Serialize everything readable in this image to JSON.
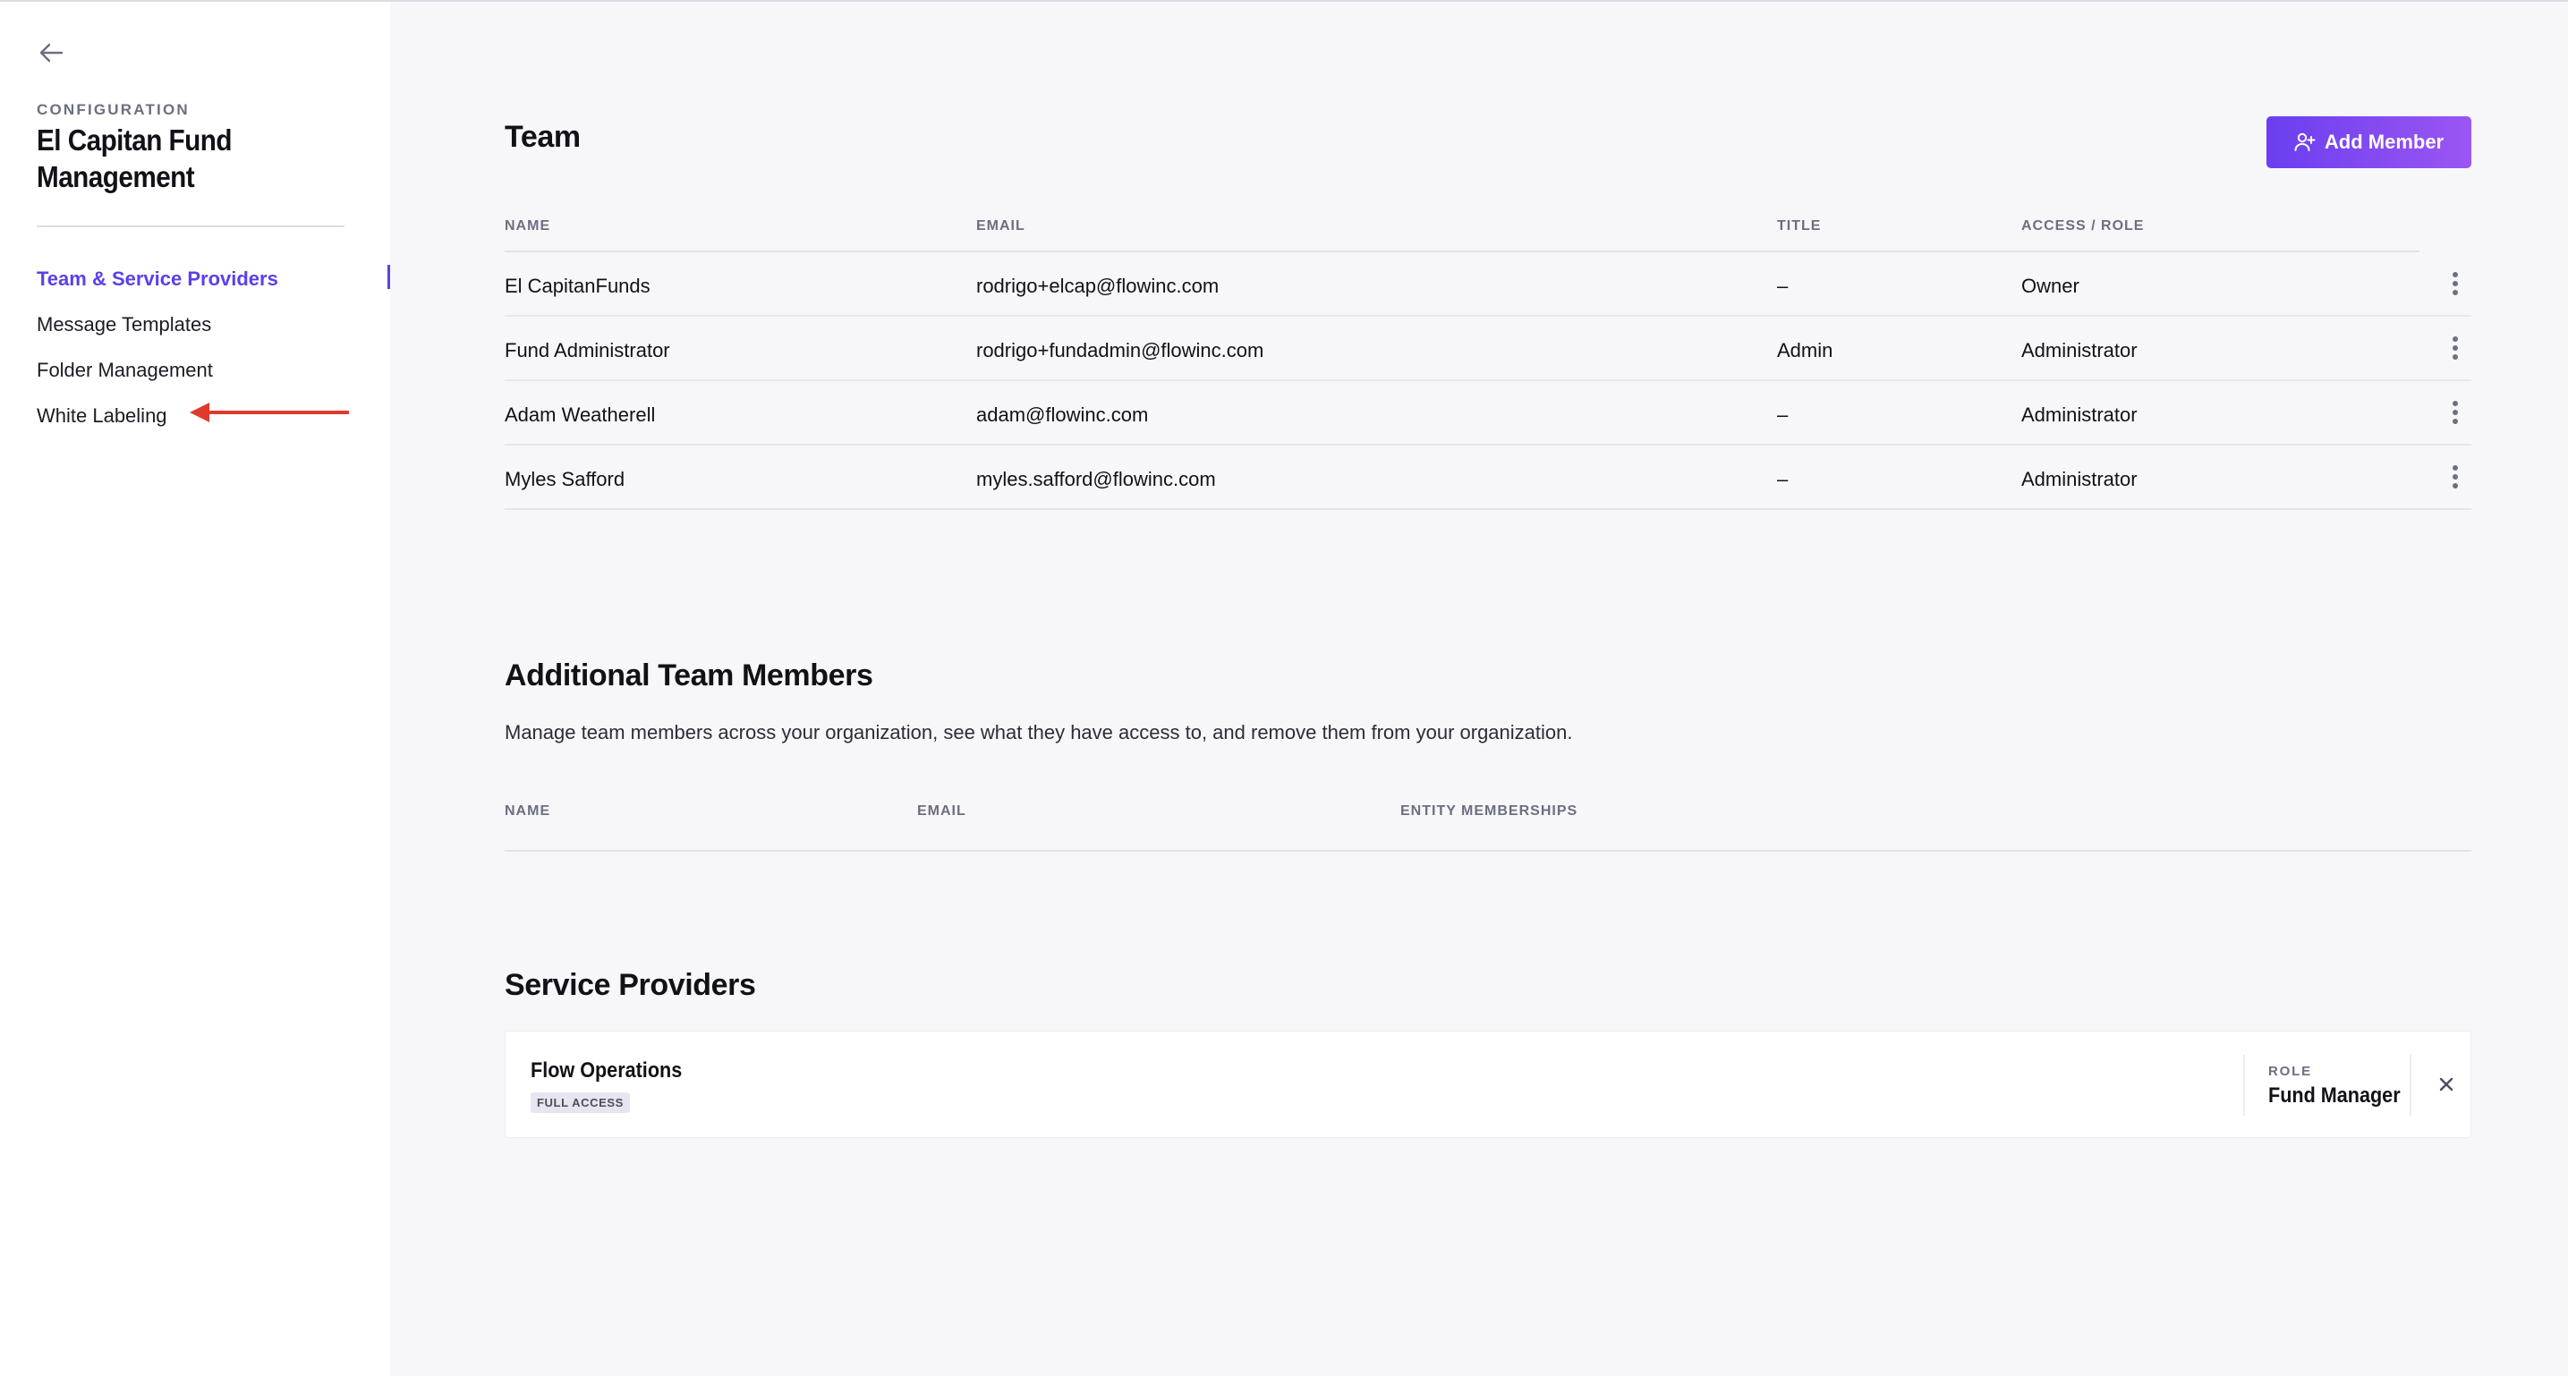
{
  "sidebar": {
    "section_label": "CONFIGURATION",
    "org_name": "El Capitan Fund Management",
    "nav": [
      {
        "label": "Team & Service Providers",
        "active": true
      },
      {
        "label": "Message Templates",
        "active": false
      },
      {
        "label": "Folder Management",
        "active": false
      },
      {
        "label": "White Labeling",
        "active": false
      }
    ]
  },
  "team": {
    "title": "Team",
    "add_button_label": "Add Member",
    "columns": [
      "NAME",
      "EMAIL",
      "TITLE",
      "ACCESS / ROLE"
    ],
    "rows": [
      {
        "name": "El CapitanFunds",
        "email": "rodrigo+elcap@flowinc.com",
        "title": "–",
        "role": "Owner"
      },
      {
        "name": "Fund Administrator",
        "email": "rodrigo+fundadmin@flowinc.com",
        "title": "Admin",
        "role": "Administrator"
      },
      {
        "name": "Adam Weatherell",
        "email": "adam@flowinc.com",
        "title": "–",
        "role": "Administrator"
      },
      {
        "name": "Myles Safford",
        "email": "myles.safford@flowinc.com",
        "title": "–",
        "role": "Administrator"
      }
    ]
  },
  "additional": {
    "title": "Additional Team Members",
    "description": "Manage team members across your organization, see what they have access to, and remove them from your organization.",
    "columns": [
      "NAME",
      "EMAIL",
      "ENTITY MEMBERSHIPS"
    ]
  },
  "providers": {
    "title": "Service Providers",
    "items": [
      {
        "name": "Flow Operations",
        "access": "FULL ACCESS",
        "role_label": "ROLE",
        "role": "Fund Manager"
      }
    ]
  },
  "colors": {
    "accent": "#5b40e8",
    "button_gradient_start": "#6a3ef0",
    "button_gradient_end": "#9b56f2",
    "annotation_arrow": "#e03a2c"
  }
}
